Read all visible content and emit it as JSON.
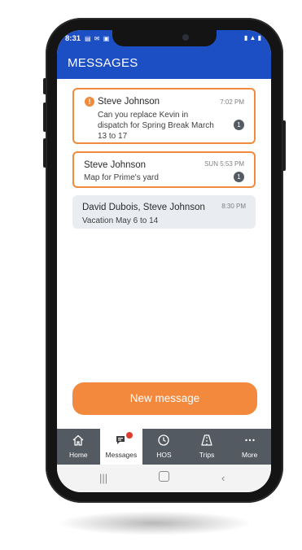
{
  "status_bar": {
    "time": "8:31",
    "left_icons": "▤ ✉ ▣",
    "right_icons": "▮ ▲ ▮"
  },
  "header": {
    "title": "MESSAGES"
  },
  "messages": [
    {
      "sender": "Steve Johnson",
      "preview": "Can you replace Kevin in dispatch for Spring Break March 13 to 17",
      "time": "7:02 PM",
      "unread_count": "1",
      "alert": "!"
    },
    {
      "sender": "Steve Johnson",
      "preview": "Map for Prime's yard",
      "time": "SUN 5:53 PM",
      "unread_count": "1"
    },
    {
      "sender": "David Dubois, Steve Johnson",
      "preview": "Vacation May 6 to 14",
      "time": "8:30 PM"
    }
  ],
  "new_message_button": "New message",
  "tabs": [
    {
      "label": "Home",
      "icon": "home-icon"
    },
    {
      "label": "Messages",
      "icon": "chat-icon",
      "active": true
    },
    {
      "label": "HOS",
      "icon": "clock-icon"
    },
    {
      "label": "Trips",
      "icon": "road-icon"
    },
    {
      "label": "More",
      "icon": "more-icon"
    }
  ],
  "colors": {
    "brand": "#1c4ec4",
    "accent": "#f2893d",
    "tabbar": "#545a62",
    "badge": "#555b63",
    "notification": "#e03b2d"
  }
}
